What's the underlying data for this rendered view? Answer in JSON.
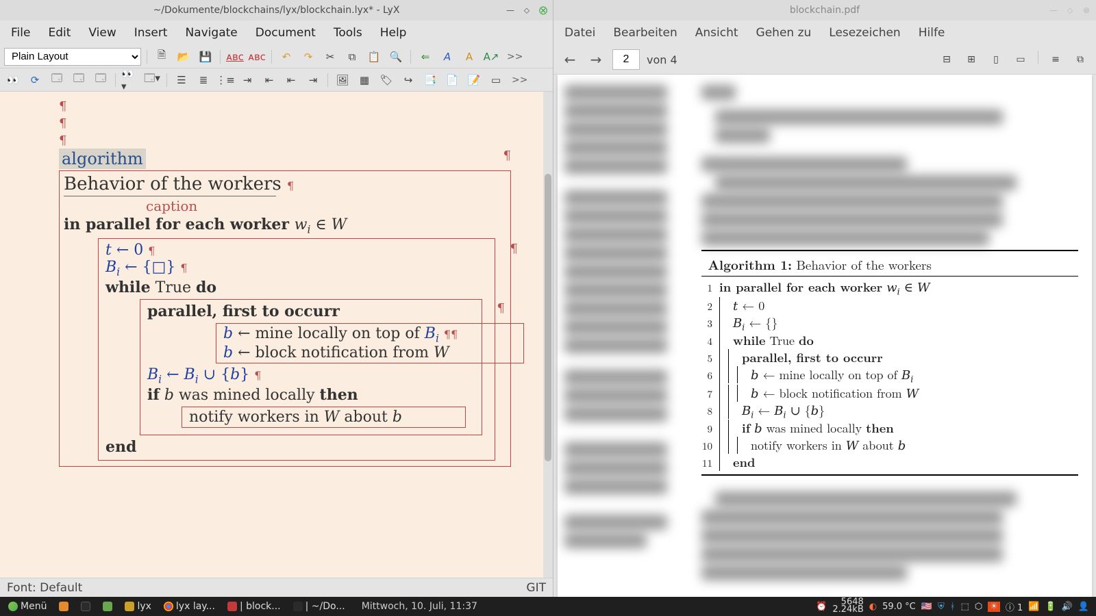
{
  "lyx": {
    "title": "~/Dokumente/blockchains/lyx/blockchain.lyx* - LyX",
    "menus": [
      "File",
      "Edit",
      "View",
      "Insert",
      "Navigate",
      "Document",
      "Tools",
      "Help"
    ],
    "layout_select": "Plain Layout",
    "overflow": ">>",
    "status_left": "Font: Default",
    "status_right": "GIT"
  },
  "editor": {
    "env_label": "algorithm",
    "caption_text": "Behavior of the workers",
    "caption_label": "caption",
    "line_forall_pre": "in parallel for each worker ",
    "line_forall_math": "w_i ∈ W",
    "t_init": "t ← 0",
    "B_init": "B_i ← {□}",
    "while_kw": "while",
    "while_cond": "True",
    "do_kw": "do",
    "parallel_first": "parallel, first to occurr",
    "mine": "b ← mine locally on top of B_i",
    "block_notif": "b ← block notification from W",
    "B_update": "B_i ← B_i ∪ {b}",
    "if_kw": "if",
    "if_cond": "b was mined locally",
    "then_kw": "then",
    "notify": "notify workers in W about b",
    "end_kw": "end",
    "pil": "¶"
  },
  "pdf": {
    "title": "blockchain.pdf",
    "menus": [
      "Datei",
      "Bearbeiten",
      "Ansicht",
      "Gehen zu",
      "Lesezeichen",
      "Hilfe"
    ],
    "page_current": "2",
    "page_of": "von 4",
    "algo_header_label": "Algorithm 1:",
    "algo_header_title": "Behavior of the workers",
    "lines": {
      "l1": "in parallel for each worker w_i ∈ W",
      "l2": "t ← 0",
      "l3": "B_i ← {}",
      "l4_a": "while",
      "l4_b": "True",
      "l4_c": "do",
      "l5": "parallel, first to occurr",
      "l6": "b ← mine locally on top of B_i",
      "l7": "b ← block notification from W",
      "l8": "B_i ← B_i ∪ {b}",
      "l9_a": "if",
      "l9_b": "b was mined locally",
      "l9_c": "then",
      "l10": "notify workers in W about b",
      "l11": "end"
    }
  },
  "taskbar": {
    "menu": "Menü",
    "items": [
      "lyx",
      "lyx lay...",
      "| block...",
      "| ~/Do..."
    ],
    "datetime": "Mittwoch, 10. Juli, 11:37",
    "temp": "59.0 °C",
    "net_up": "5648",
    "net_down": "2.24kB"
  }
}
